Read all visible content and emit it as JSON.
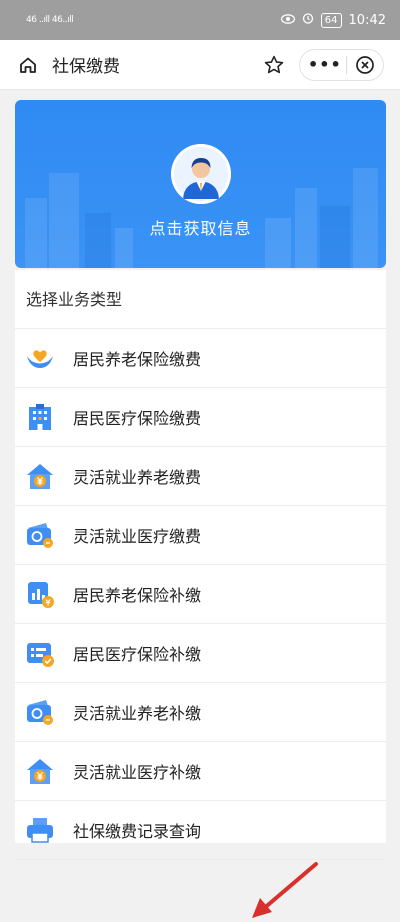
{
  "status_bar": {
    "time": "10:42",
    "battery": "64",
    "signal_left": "46 ..ıll 46..ıll"
  },
  "nav": {
    "title": "社保缴费",
    "more": "•••"
  },
  "banner": {
    "text": "点击获取信息"
  },
  "section_title": "选择业务类型",
  "items": [
    {
      "label": "居民养老保险缴费",
      "icon": "hands-heart-icon"
    },
    {
      "label": "居民医疗保险缴费",
      "icon": "hospital-building-icon"
    },
    {
      "label": "灵活就业养老缴费",
      "icon": "house-yuan-icon"
    },
    {
      "label": "灵活就业医疗缴费",
      "icon": "wallet-card-icon"
    },
    {
      "label": "居民养老保险补缴",
      "icon": "chart-coin-icon"
    },
    {
      "label": "居民医疗保险补缴",
      "icon": "document-check-icon"
    },
    {
      "label": "灵活就业养老补缴",
      "icon": "wallet-card-icon"
    },
    {
      "label": "灵活就业医疗补缴",
      "icon": "house-yuan-icon"
    },
    {
      "label": "社保缴费记录查询",
      "icon": "printer-icon"
    }
  ],
  "colors": {
    "accent": "#2f8af3",
    "annotation_arrow": "#d9302c",
    "icon_blue": "#3f8ef3",
    "icon_orange": "#f5a623"
  }
}
